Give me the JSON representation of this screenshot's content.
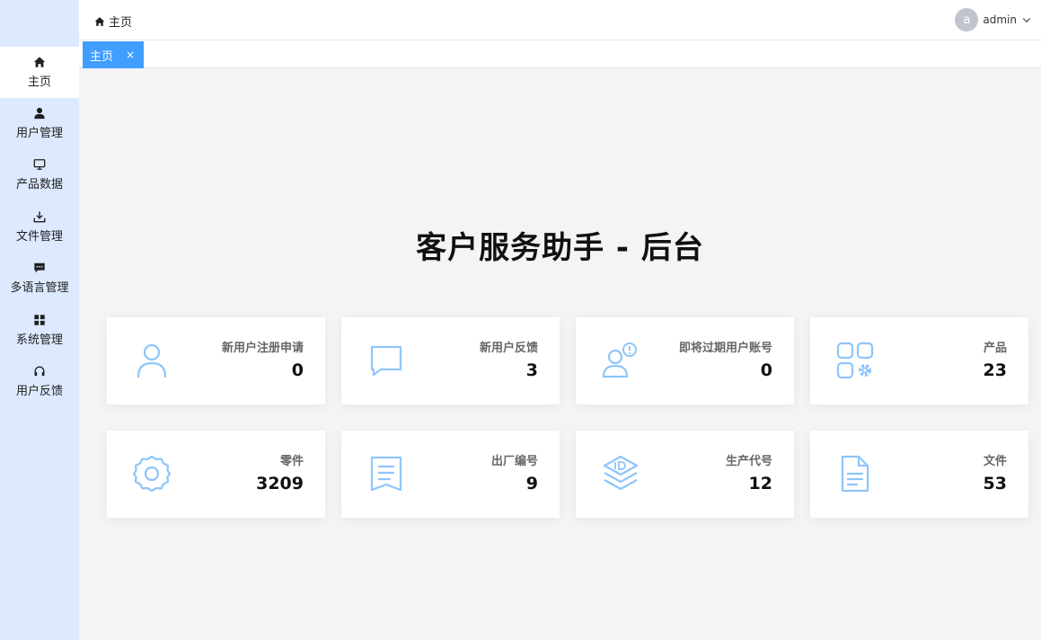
{
  "sidebar": {
    "items": [
      {
        "label": "主页",
        "icon": "home-icon",
        "active": true
      },
      {
        "label": "用户管理",
        "icon": "user-icon"
      },
      {
        "label": "产品数据",
        "icon": "monitor-icon"
      },
      {
        "label": "文件管理",
        "icon": "download-icon"
      },
      {
        "label": "多语言管理",
        "icon": "chat-icon"
      },
      {
        "label": "系统管理",
        "icon": "grid-icon"
      },
      {
        "label": "用户反馈",
        "icon": "headset-icon"
      }
    ]
  },
  "header": {
    "breadcrumb": "主页",
    "user": {
      "avatar_letter": "a",
      "name": "admin"
    }
  },
  "tabs": [
    {
      "label": "主页",
      "close": "×"
    }
  ],
  "main": {
    "title": "客户服务助手 - 后台",
    "cards": [
      {
        "label": "新用户注册申请",
        "value": "0",
        "icon": "user-icon"
      },
      {
        "label": "新用户反馈",
        "value": "3",
        "icon": "chat-bubble-icon"
      },
      {
        "label": "即将过期用户账号",
        "value": "0",
        "icon": "user-alert-icon"
      },
      {
        "label": "产品",
        "value": "23",
        "icon": "apps-settings-icon"
      },
      {
        "label": "零件",
        "value": "3209",
        "icon": "gear-icon"
      },
      {
        "label": "出厂编号",
        "value": "9",
        "icon": "document-icon"
      },
      {
        "label": "生产代号",
        "value": "12",
        "icon": "id-layers-icon"
      },
      {
        "label": "文件",
        "value": "53",
        "icon": "file-icon"
      }
    ]
  },
  "colors": {
    "sidebar_bg": "#dce9fe",
    "accent": "#409eff",
    "icon_color": "#8ec5fb",
    "page_bg": "#f4f4f4"
  }
}
